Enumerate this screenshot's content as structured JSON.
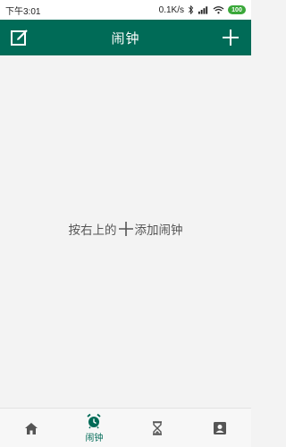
{
  "status_bar": {
    "time": "下午3:01",
    "network_speed": "0.1K/s",
    "battery": "100"
  },
  "header": {
    "title": "闹钟",
    "left_icon": "edit-icon",
    "right_icon": "plus-icon"
  },
  "content": {
    "empty_hint_before": "按右上的",
    "empty_hint_after": "添加闹钟"
  },
  "bottom_nav": {
    "items": [
      {
        "icon": "home-icon",
        "label": ""
      },
      {
        "icon": "alarm-clock-icon",
        "label": "闹钟",
        "active": true
      },
      {
        "icon": "hourglass-icon",
        "label": ""
      },
      {
        "icon": "profile-icon",
        "label": ""
      }
    ]
  },
  "colors": {
    "primary": "#006b57",
    "background": "#f3f3f3"
  }
}
